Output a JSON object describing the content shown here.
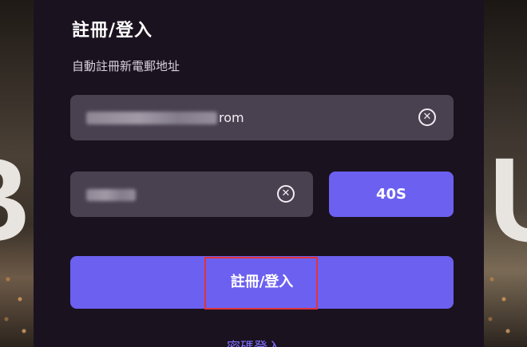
{
  "modal": {
    "title": "註冊/登入",
    "subtitle": "自動註冊新電郵地址"
  },
  "email_field": {
    "visible_value_suffix": "rom",
    "clear_icon": "close-circle-icon"
  },
  "code_field": {
    "clear_icon": "close-circle-icon"
  },
  "countdown_button": {
    "label": "40S"
  },
  "primary_button": {
    "label": "註冊/登入"
  },
  "password_login_link": {
    "label": "密碼登入"
  },
  "colors": {
    "modal_background": "#1b1220",
    "input_background": "#4a4150",
    "accent": "#6c60f0",
    "link": "#7f72ff",
    "highlight_box": "#e0343b"
  }
}
